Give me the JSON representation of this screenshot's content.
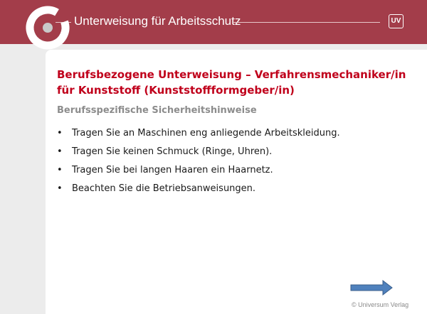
{
  "header": {
    "title": "Unterweisung für Arbeitsschutz",
    "badge": "UV",
    "color": "#a33d4a"
  },
  "slide": {
    "title": "Berufsbezogene Unterweisung – Verfahrensmechaniker/in für Kunststoff (Kunststoffformgeber/in)",
    "subtitle": "Berufsspezifische Sicherheitshinweise",
    "bullets": [
      "Tragen Sie an Maschinen eng anliegende Arbeitskleidung.",
      "Tragen Sie keinen Schmuck (Ringe, Uhren).",
      "Tragen Sie bei langen Haaren ein Haarnetz.",
      "Beachten Sie die Betriebsanweisungen."
    ],
    "title_color": "#c0001b"
  },
  "footer": {
    "copyright": "© Universum Verlag"
  },
  "icons": {
    "logo": "circle-target-logo-icon",
    "next": "right-arrow-icon"
  }
}
